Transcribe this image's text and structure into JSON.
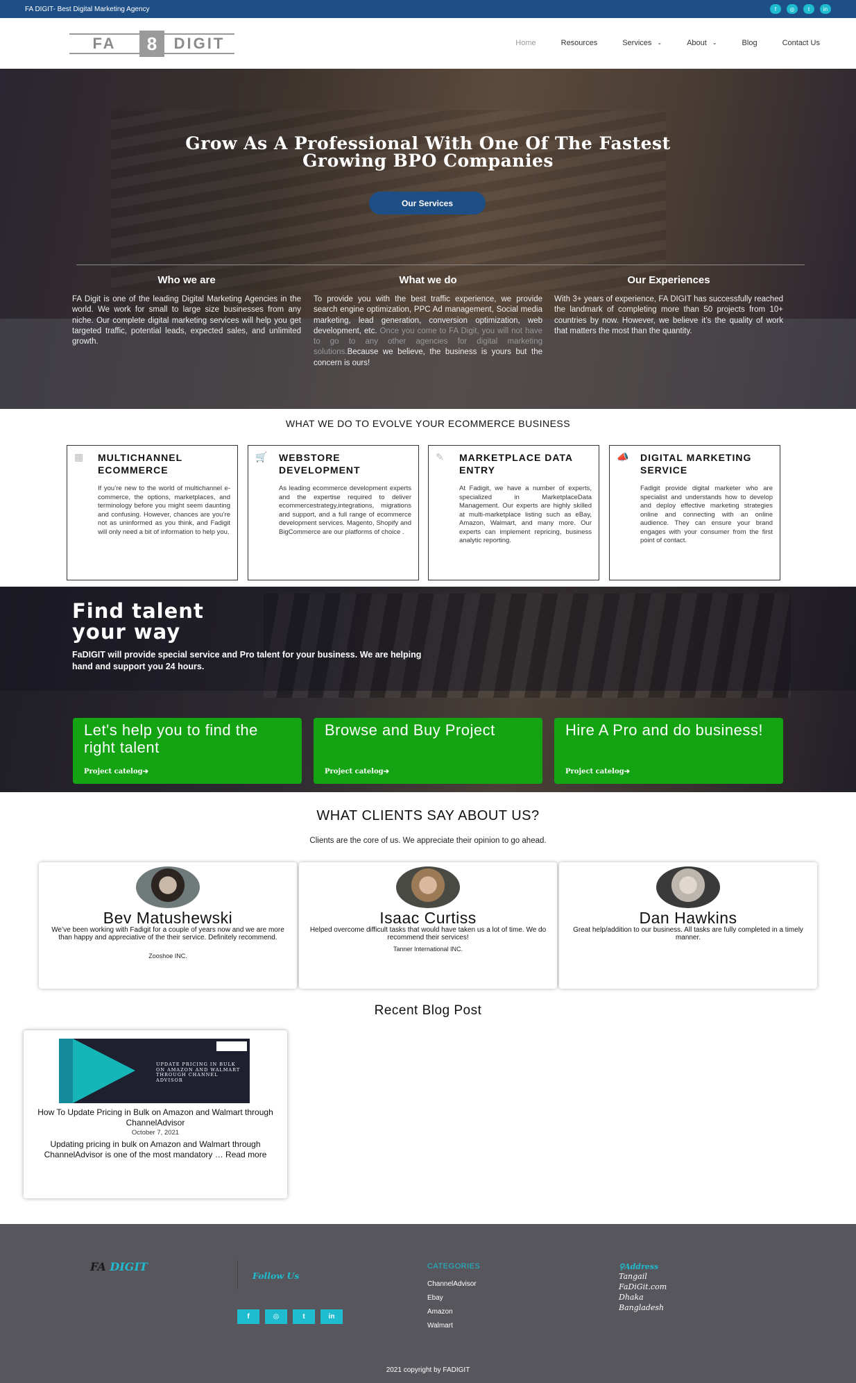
{
  "topbar": {
    "tagline": "FA DIGIT- Best Digital Marketing Agency",
    "social_icons": [
      "facebook-icon",
      "instagram-icon",
      "twitter-icon",
      "linkedin-icon"
    ]
  },
  "logo": {
    "left": "FA",
    "mid": "8",
    "right": "DIGIT"
  },
  "nav": {
    "home": "Home",
    "resources": "Resources",
    "services": "Services",
    "about": "About",
    "blog": "Blog",
    "contact": "Contact Us"
  },
  "hero": {
    "title_line1": "Grow As A Professional With One Of The Fastest",
    "title_line2": "Growing BPO Companies",
    "button": "Our Services",
    "cols": [
      {
        "title": "Who we are",
        "text": "FA Digit is one of the leading Digital Marketing Agencies in the world. We work for small to large size businesses from any niche. Our complete digital marketing services will help you get targeted traffic, potential leads, expected sales, and unlimited growth."
      },
      {
        "title": "What we do",
        "text_a": "To provide you with the best traffic experience, we provide search engine optimization, PPC Ad management, Social media marketing, lead generation, conversion optimization, web development, etc. ",
        "text_faint": "Once you come to FA Digit, you will not have to go to any other agencies for digital marketing solutions.",
        "text_b": "Because we believe, the business is yours but the concern is ours!"
      },
      {
        "title": "Our Experiences",
        "text": "With 3+ years of experience, FA DIGIT has successfully reached the landmark of completing more than 50 projects from 10+ countries by now. However, we believe it’s the quality of work that matters the most than the quantity."
      }
    ]
  },
  "evolve": {
    "title": "WHAT WE DO TO EVOLVE YOUR ECOMMERCE BUSINESS",
    "cards": [
      {
        "icon": "grid-icon",
        "title": "MULTICHANNEL ECOMMERCE",
        "text": "If you’re new to the world of multichannel e-commerce, the options, marketplaces, and terminology before you might seem daunting and confusing. However, chances are you’re not as uninformed as you think, and Fadigit will only need a bit of information to help you."
      },
      {
        "icon": "cart-icon",
        "title": "WEBSTORE DEVELOPMENT",
        "text": "As leading ecommerce development experts and the expertise required to deliver ecommercestrategy,integrations, migrations and support, and a full range of ecommerce development services. Magento, Shopify and BigCommerce are our platforms of choice ."
      },
      {
        "icon": "edit-icon",
        "title": "MARKETPLACE DATA ENTRY",
        "text": "At Fadigit, we have a number of experts, specialized in MarketplaceData Management. Our experts are highly skilled at multi-marketplace listing such as eBay, Amazon, Walmart, and many more. Our experts can implement repricing, business analytic reporting."
      },
      {
        "icon": "megaphone-icon",
        "title": "DIGITAL MARKETING SERVICE",
        "text": "Fadigit provide digital marketer who are specialist and understands how to develop and deploy effective marketing strategies online and connecting with an online audience. They can ensure your brand engages with your consumer from the first point of contact."
      }
    ]
  },
  "talent": {
    "title_line1": "Find talent",
    "title_line2": "your way",
    "subtitle": "FaDIGIT will provide special service and Pro talent for your business. We are helping hand and support you 24 hours.",
    "boxes": [
      {
        "title": "Let's help you to find the right talent",
        "link": "Project catelog"
      },
      {
        "title": "Browse and Buy Project",
        "link": "Project catelog"
      },
      {
        "title": "Hire A Pro and do business!",
        "link": "Project catelog"
      }
    ]
  },
  "clients": {
    "title": "WHAT CLIENTS SAY ABOUT US?",
    "subtitle": "Clients are the core of us. We appreciate their opinion to go ahead.",
    "items": [
      {
        "name": "Bev Matushewski",
        "quote": "We’ve been working with Fadigit for a couple of years now and we are more than happy and appreciative of the their service. Definitely recommend.",
        "company": "Zooshoe INC."
      },
      {
        "name": "Isaac Curtiss",
        "quote": "Helped overcome difficult tasks that would have taken us a lot of time. We do recommend their services!",
        "company": "Tanner International INC."
      },
      {
        "name": "Dan Hawkins",
        "quote": "Great help/addition to our business. All tasks are fully completed in a timely manner.",
        "company": ""
      }
    ]
  },
  "blog": {
    "section_title": "Recent Blog Post",
    "image_text": "UPDATE PRICING IN BULK ON AMAZON AND WALMART THROUGH CHANNEL ADVISOR",
    "post_title": "How To Update Pricing in Bulk on Amazon and Walmart through ChannelAdvisor",
    "date": "October 7, 2021",
    "excerpt": "Updating pricing in bulk on Amazon and Walmart through ChannelAdvisor is one of the most mandatory … Read more"
  },
  "footer": {
    "logo_a": "FA",
    "logo_b": "DIGIT",
    "follow": "Follow Us",
    "social": [
      "f",
      "◎",
      "t",
      "in"
    ],
    "categories_title": "CATEGORIES",
    "categories": [
      "ChannelAdvisor",
      "Ebay",
      "Amazon",
      "Walmart"
    ],
    "address_title": "Address",
    "address": [
      "Tangail",
      "FaDiGit.com",
      "Dhaka",
      "Bangladesh"
    ],
    "copyright": "2021 copyright by FADIGIT"
  }
}
